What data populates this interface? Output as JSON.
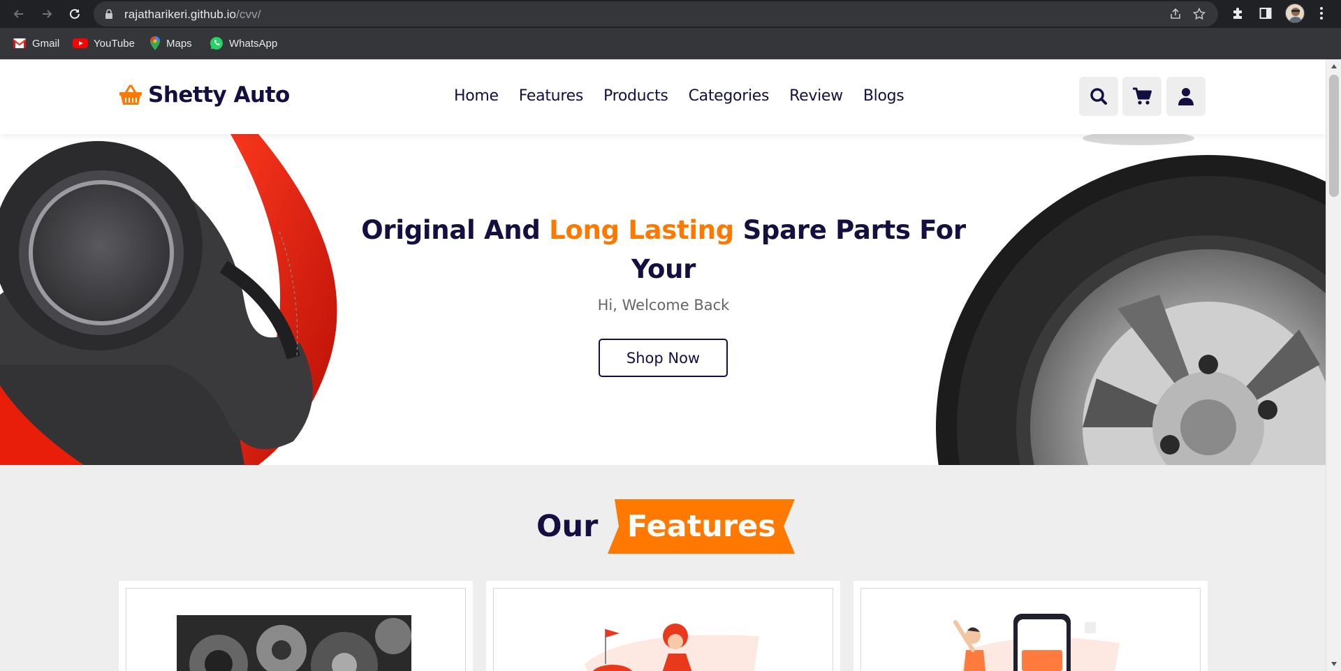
{
  "browser": {
    "url_host": "rajatharikeri.github.io",
    "url_path": "/cvv/",
    "bookmarks": [
      {
        "label": "Gmail",
        "icon": "gmail-icon"
      },
      {
        "label": "YouTube",
        "icon": "youtube-icon"
      },
      {
        "label": "Maps",
        "icon": "maps-icon"
      },
      {
        "label": "WhatsApp",
        "icon": "whatsapp-icon"
      }
    ]
  },
  "header": {
    "logo_text": "Shetty Auto",
    "nav": [
      "Home",
      "Features",
      "Products",
      "Categories",
      "Review",
      "Blogs"
    ],
    "icons": [
      "search-icon",
      "cart-icon",
      "user-icon"
    ]
  },
  "hero": {
    "title_part1": "Original And ",
    "title_accent": "Long Lasting",
    "title_part2": " Spare Parts For Your",
    "subtitle": "Hi, Welcome Back",
    "button": "Shop Now"
  },
  "features": {
    "heading_plain": "Our",
    "heading_tag": "Features"
  },
  "colors": {
    "brand_dark": "#130f40",
    "accent": "#ff7800",
    "page_bg": "#eeeeee"
  }
}
